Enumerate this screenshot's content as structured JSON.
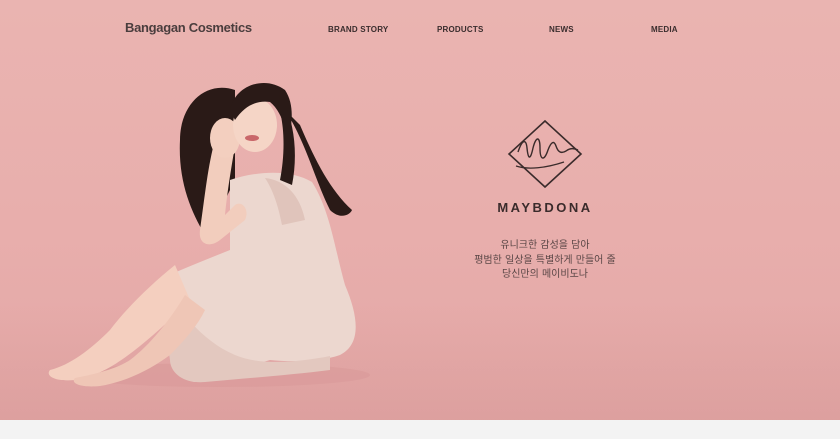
{
  "header": {
    "logo_text": "Bangagan Cosmetics",
    "nav": {
      "brand_story": "BRAND STORY",
      "products": "PRODUCTS",
      "news": "NEWS",
      "media": "MEDIA"
    }
  },
  "hero": {
    "background_color": "#e9b1af",
    "brand_name": "MAYBDONA",
    "tagline": [
      "유니크한 감성을 담아",
      "평범한 일상을 특별하게 만들어 줄",
      "당신만의 메이비도나"
    ]
  }
}
